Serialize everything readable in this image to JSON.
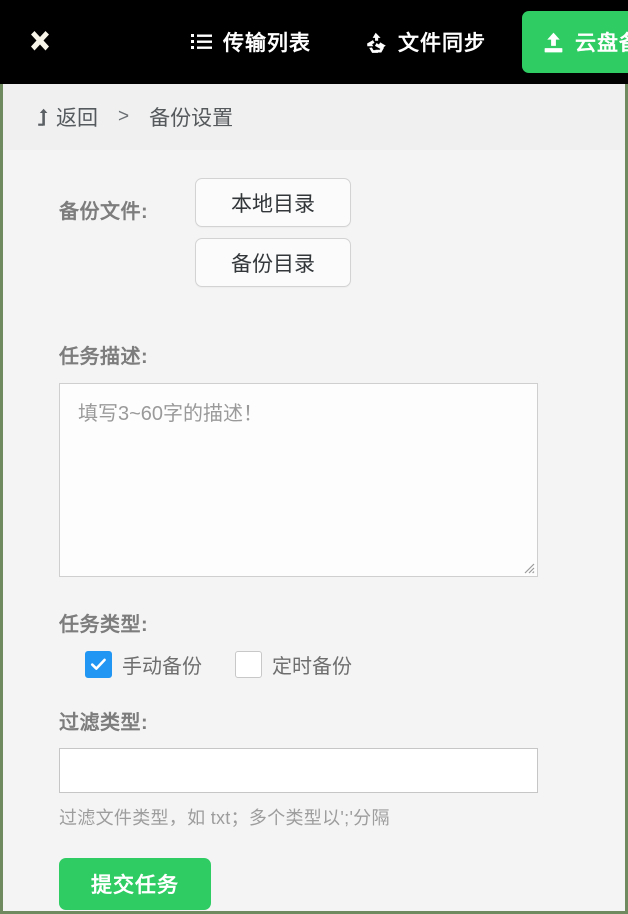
{
  "window": {
    "close_label": "×"
  },
  "topnav": {
    "items": [
      {
        "id": "transfer-list",
        "label": "传输列表",
        "icon": "list-icon",
        "active": false
      },
      {
        "id": "file-sync",
        "label": "文件同步",
        "icon": "recycle-sync-icon",
        "active": false
      },
      {
        "id": "cloud-backup",
        "label": "云盘备份",
        "icon": "upload-icon",
        "active": true
      }
    ],
    "active_bg": "#2ecc63",
    "bar_bg": "#000000",
    "text_color": "#ffffff"
  },
  "breadcrumb": {
    "back_label": "返回",
    "back_icon": "back-arrow-icon",
    "separator": ">",
    "current": "备份设置"
  },
  "form": {
    "backup_files": {
      "label": "备份文件:",
      "buttons": [
        {
          "id": "local-dir",
          "label": "本地目录"
        },
        {
          "id": "backup-dir",
          "label": "备份目录"
        }
      ]
    },
    "description": {
      "label": "任务描述:",
      "placeholder": "填写3~60字的描述！",
      "value": ""
    },
    "task_type": {
      "label": "任务类型:",
      "options": [
        {
          "id": "manual-backup",
          "label": "手动备份",
          "checked": true
        },
        {
          "id": "scheduled-backup",
          "label": "定时备份",
          "checked": false
        }
      ],
      "checked_color": "#2196f3"
    },
    "filter_type": {
      "label": "过滤类型:",
      "value": "",
      "placeholder": "",
      "hint": "过滤文件类型，如 txt；多个类型以';'分隔"
    },
    "submit": {
      "label": "提交任务",
      "color": "#2ecc63"
    }
  },
  "theme": {
    "page_bg": "#f4f4f4",
    "breadcrumb_bg": "#f0f0f0",
    "window_border": "#6f8a5e",
    "label_color": "#7d7d7d"
  }
}
